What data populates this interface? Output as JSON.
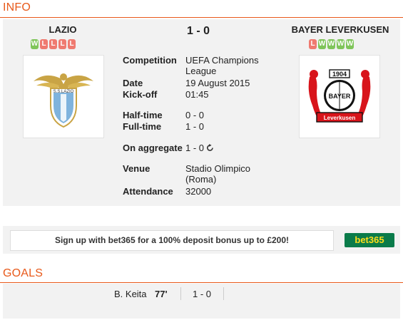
{
  "info": {
    "section_title": "INFO",
    "home": {
      "name": "LAZIO",
      "form": [
        "W",
        "L",
        "L",
        "L",
        "L"
      ],
      "logo_text": "S.S.LAZIO"
    },
    "away": {
      "name": "BAYER LEVERKUSEN",
      "form": [
        "L",
        "W",
        "W",
        "W",
        "W"
      ],
      "logo_year": "1904",
      "logo_name": "Leverkusen",
      "logo_bayer": "BAYER"
    },
    "score": "1 - 0",
    "details": {
      "competition_label": "Competition",
      "competition_line1": "UEFA Champions",
      "competition_line2": "League",
      "date_label": "Date",
      "date": "19 August 2015",
      "kickoff_label": "Kick-off",
      "kickoff": "01:45",
      "halftime_label": "Half-time",
      "halftime": "0 - 0",
      "fulltime_label": "Full-time",
      "fulltime": "1 - 0",
      "aggregate_label": "On aggregate",
      "aggregate": "1 - 0",
      "venue_label": "Venue",
      "venue_line1": "Stadio Olimpico",
      "venue_line2": "(Roma)",
      "attendance_label": "Attendance",
      "attendance": "32000"
    }
  },
  "banner": {
    "text": "Sign up with bet365 for a 100% deposit bonus up to £200!",
    "logo": "bet365"
  },
  "goals": {
    "section_title": "GOALS",
    "items": [
      {
        "player": "B. Keita",
        "minute": "77'",
        "score": "1 - 0"
      }
    ]
  },
  "colors": {
    "accent": "#e8591a",
    "win": "#7fc55a",
    "loss": "#ef7a70",
    "bet365_green": "#0a7b4a",
    "bet365_yellow": "#ffdf1b"
  },
  "icons": [
    "aggregate-arrow-icon",
    "lazio-crest-icon",
    "leverkusen-crest-icon"
  ]
}
